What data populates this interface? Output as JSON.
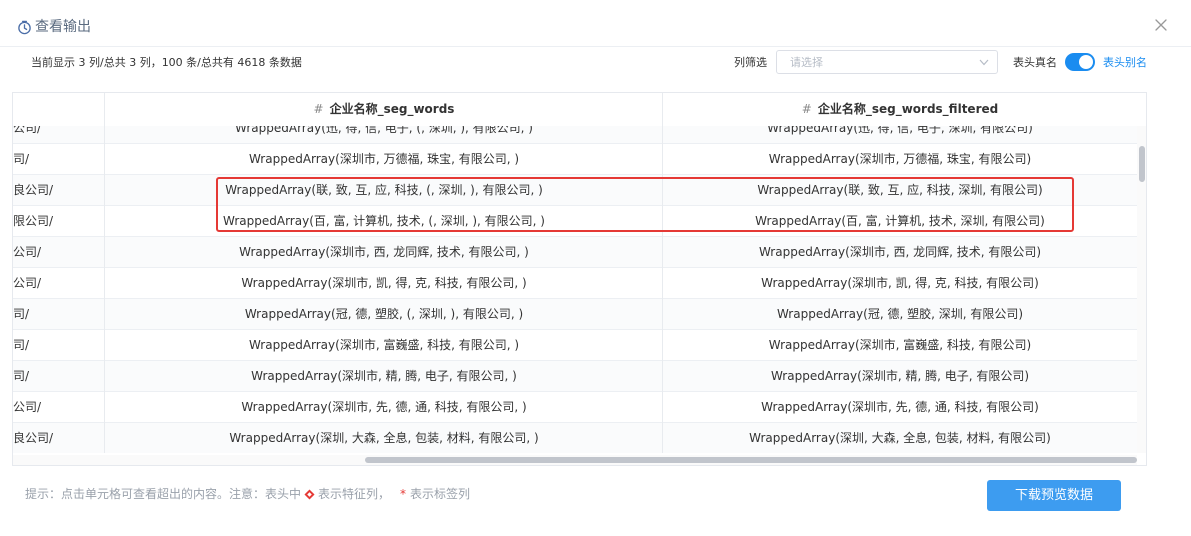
{
  "header": {
    "title": "查看输出",
    "icons": {
      "title": "clock-icon",
      "close": "close-icon"
    }
  },
  "toolbar": {
    "summary": "当前显示 3 列/总共 3 列，100 条/总共有 4618 条数据",
    "filter_label": "列筛选",
    "filter_placeholder": "请选择",
    "real_name_label": "表头真名",
    "switch_on": true,
    "alias_label": "表头别名"
  },
  "table": {
    "columns": [
      {
        "hash": "",
        "name": ""
      },
      {
        "hash": "#",
        "name": "企业名称_seg_words"
      },
      {
        "hash": "#",
        "name": "企业名称_seg_words_filtered"
      }
    ],
    "rows": [
      [
        "公司/",
        "WrappedArray(迅, 得, 信, 电子, (, 深圳, ), 有限公司, )",
        "WrappedArray(迅, 得, 信, 电子, 深圳, 有限公司)"
      ],
      [
        "司/",
        "WrappedArray(深圳市, 万德福, 珠宝, 有限公司, )",
        "WrappedArray(深圳市, 万德福, 珠宝, 有限公司)"
      ],
      [
        "良公司/",
        "WrappedArray(联, 致, 互, 应, 科技, (, 深圳, ), 有限公司, )",
        "WrappedArray(联, 致, 互, 应, 科技, 深圳, 有限公司)"
      ],
      [
        "限公司/",
        "WrappedArray(百, 富, 计算机, 技术, (, 深圳, ), 有限公司, )",
        "WrappedArray(百, 富, 计算机, 技术, 深圳, 有限公司)"
      ],
      [
        "公司/",
        "WrappedArray(深圳市, 西, 龙同辉, 技术, 有限公司, )",
        "WrappedArray(深圳市, 西, 龙同辉, 技术, 有限公司)"
      ],
      [
        "公司/",
        "WrappedArray(深圳市, 凯, 得, 克, 科技, 有限公司, )",
        "WrappedArray(深圳市, 凯, 得, 克, 科技, 有限公司)"
      ],
      [
        "司/",
        "WrappedArray(冠, 德, 塑胶, (, 深圳, ), 有限公司, )",
        "WrappedArray(冠, 德, 塑胶, 深圳, 有限公司)"
      ],
      [
        "司/",
        "WrappedArray(深圳市, 富巍盛, 科技, 有限公司, )",
        "WrappedArray(深圳市, 富巍盛, 科技, 有限公司)"
      ],
      [
        "司/",
        "WrappedArray(深圳市, 精, 腾, 电子, 有限公司, )",
        "WrappedArray(深圳市, 精, 腾, 电子, 有限公司)"
      ],
      [
        "公司/",
        "WrappedArray(深圳市, 先, 德, 通, 科技, 有限公司, )",
        "WrappedArray(深圳市, 先, 德, 通, 科技, 有限公司)"
      ],
      [
        "良公司/",
        "WrappedArray(深圳, 大森, 全息, 包装, 材料, 有限公司, )",
        "WrappedArray(深圳, 大森, 全息, 包装, 材料, 有限公司)"
      ]
    ]
  },
  "footer": {
    "hint_prefix": "提示：点击单元格可查看超出的内容。注意：表头中",
    "hint_feature": "表示特征列，",
    "hint_star": "*",
    "hint_label": "表示标签列",
    "download_label": "下载预览数据",
    "feature_icon": "diamond-icon"
  },
  "colors": {
    "accent": "#1a8cf0",
    "button": "#3d9cf0",
    "highlight": "#e53935",
    "title": "#5b6b80"
  }
}
